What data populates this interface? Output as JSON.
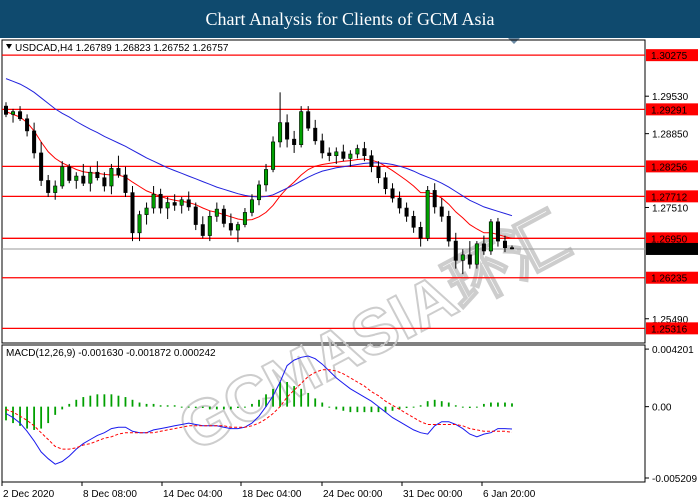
{
  "header": {
    "title": "Chart Analysis for Clients of GCM Asia"
  },
  "watermark": {
    "text": "GCMASIA环汇"
  },
  "chart_data": [
    {
      "type": "candlestick",
      "symbol_line": "USDCAD,H4  1.26789 1.26823 1.26752 1.26757",
      "ylim": [
        1.2505,
        1.3055
      ],
      "y_ticks": [
        "1.29530",
        "1.28850",
        "1.27510",
        "1.25490"
      ],
      "x_ticks": [
        "2 Dec 2020",
        "8 Dec 08:00",
        "14 Dec 04:00",
        "18 Dec 04:00",
        "24 Dec 00:00",
        "31 Dec 00:00",
        "6 Jan 20:00"
      ],
      "current_price": "1.26757",
      "levels": [
        "1.30275",
        "1.29291",
        "1.28256",
        "1.27712",
        "1.26950",
        "1.26235",
        "1.25316"
      ],
      "level_color": "#ff0000",
      "candles": [
        [
          1.2935,
          1.2942,
          1.2915,
          1.292
        ],
        [
          1.292,
          1.293,
          1.2905,
          1.2925
        ],
        [
          1.2925,
          1.2935,
          1.2908,
          1.2912
        ],
        [
          1.2912,
          1.292,
          1.288,
          1.289
        ],
        [
          1.289,
          1.2905,
          1.284,
          1.285
        ],
        [
          1.285,
          1.287,
          1.279,
          1.28
        ],
        [
          1.28,
          1.281,
          1.277,
          1.2778
        ],
        [
          1.2778,
          1.28,
          1.2765,
          1.279
        ],
        [
          1.279,
          1.2835,
          1.2785,
          1.2825
        ],
        [
          1.2825,
          1.283,
          1.2795,
          1.28
        ],
        [
          1.28,
          1.2815,
          1.2785,
          1.2808
        ],
        [
          1.2808,
          1.283,
          1.279,
          1.2795
        ],
        [
          1.2795,
          1.2825,
          1.278,
          1.2815
        ],
        [
          1.2815,
          1.2835,
          1.28,
          1.2805
        ],
        [
          1.2805,
          1.2815,
          1.278,
          1.279
        ],
        [
          1.279,
          1.283,
          1.2775,
          1.2822
        ],
        [
          1.2822,
          1.2845,
          1.2805,
          1.281
        ],
        [
          1.281,
          1.2825,
          1.277,
          1.2778
        ],
        [
          1.2778,
          1.279,
          1.269,
          1.2705
        ],
        [
          1.2705,
          1.2745,
          1.269,
          1.2738
        ],
        [
          1.2738,
          1.276,
          1.272,
          1.275
        ],
        [
          1.275,
          1.279,
          1.274,
          1.2775
        ],
        [
          1.2775,
          1.2785,
          1.274,
          1.275
        ],
        [
          1.275,
          1.277,
          1.273,
          1.276
        ],
        [
          1.276,
          1.2775,
          1.2745,
          1.2755
        ],
        [
          1.2755,
          1.277,
          1.274,
          1.2765
        ],
        [
          1.2765,
          1.278,
          1.2745,
          1.2752
        ],
        [
          1.2752,
          1.276,
          1.271,
          1.272
        ],
        [
          1.272,
          1.2735,
          1.2695,
          1.27
        ],
        [
          1.27,
          1.2745,
          1.269,
          1.2735
        ],
        [
          1.2735,
          1.276,
          1.2725,
          1.2748
        ],
        [
          1.2748,
          1.2755,
          1.2715,
          1.2722
        ],
        [
          1.2722,
          1.274,
          1.27,
          1.271
        ],
        [
          1.271,
          1.2725,
          1.2688,
          1.272
        ],
        [
          1.272,
          1.275,
          1.2715,
          1.2742
        ],
        [
          1.2742,
          1.2775,
          1.2735,
          1.2765
        ],
        [
          1.2765,
          1.28,
          1.2755,
          1.2792
        ],
        [
          1.2792,
          1.283,
          1.278,
          1.282
        ],
        [
          1.282,
          1.288,
          1.2815,
          1.287
        ],
        [
          1.287,
          1.296,
          1.286,
          1.2905
        ],
        [
          1.2905,
          1.292,
          1.286,
          1.2875
        ],
        [
          1.2875,
          1.289,
          1.285,
          1.2865
        ],
        [
          1.2865,
          1.2935,
          1.286,
          1.2925
        ],
        [
          1.2925,
          1.2935,
          1.289,
          1.2895
        ],
        [
          1.2895,
          1.291,
          1.2865,
          1.2872
        ],
        [
          1.2872,
          1.2885,
          1.284,
          1.285
        ],
        [
          1.285,
          1.286,
          1.2835,
          1.2845
        ],
        [
          1.2845,
          1.286,
          1.283,
          1.2852
        ],
        [
          1.2852,
          1.2865,
          1.2835,
          1.284
        ],
        [
          1.284,
          1.2855,
          1.2825,
          1.2848
        ],
        [
          1.2848,
          1.2865,
          1.284,
          1.2858
        ],
        [
          1.2858,
          1.287,
          1.2835,
          1.2845
        ],
        [
          1.2845,
          1.2855,
          1.2815,
          1.2825
        ],
        [
          1.2825,
          1.2835,
          1.2795,
          1.2805
        ],
        [
          1.2805,
          1.2815,
          1.2775,
          1.2785
        ],
        [
          1.2785,
          1.2795,
          1.276,
          1.2768
        ],
        [
          1.2768,
          1.278,
          1.274,
          1.275
        ],
        [
          1.275,
          1.276,
          1.2725,
          1.2735
        ],
        [
          1.2735,
          1.2745,
          1.2705,
          1.2715
        ],
        [
          1.2715,
          1.2725,
          1.268,
          1.2695
        ],
        [
          1.2695,
          1.279,
          1.269,
          1.2782
        ],
        [
          1.2782,
          1.2795,
          1.274,
          1.2752
        ],
        [
          1.2752,
          1.2768,
          1.2725,
          1.2735
        ],
        [
          1.2735,
          1.2745,
          1.268,
          1.269
        ],
        [
          1.269,
          1.2705,
          1.264,
          1.2655
        ],
        [
          1.2655,
          1.2675,
          1.263,
          1.2665
        ],
        [
          1.2665,
          1.269,
          1.264,
          1.2648
        ],
        [
          1.2648,
          1.269,
          1.264,
          1.2685
        ],
        [
          1.2685,
          1.27,
          1.2665,
          1.2672
        ],
        [
          1.2672,
          1.273,
          1.2665,
          1.2725
        ],
        [
          1.2725,
          1.2732,
          1.268,
          1.269
        ],
        [
          1.269,
          1.27,
          1.267,
          1.2678
        ],
        [
          1.2678,
          1.2682,
          1.2675,
          1.26757
        ]
      ],
      "ma_series": [
        {
          "color": "#ff0000",
          "values": [
            1.2925,
            1.292,
            1.2915,
            1.2905,
            1.289,
            1.287,
            1.2852,
            1.284,
            1.2832,
            1.2826,
            1.282,
            1.2816,
            1.2814,
            1.2813,
            1.2811,
            1.281,
            1.281,
            1.2806,
            1.2797,
            1.2789,
            1.2781,
            1.2776,
            1.2771,
            1.2767,
            1.2764,
            1.2762,
            1.276,
            1.2756,
            1.275,
            1.2745,
            1.2742,
            1.2738,
            1.2734,
            1.273,
            1.2728,
            1.2729,
            1.2734,
            1.2742,
            1.2755,
            1.2772,
            1.2786,
            1.2797,
            1.281,
            1.282,
            1.2826,
            1.2829,
            1.2831,
            1.2833,
            1.2835,
            1.2836,
            1.2838,
            1.2839,
            1.2837,
            1.2833,
            1.2826,
            1.2818,
            1.2809,
            1.28,
            1.279,
            1.2778,
            1.2778,
            1.2775,
            1.2768,
            1.2757,
            1.2743,
            1.2732,
            1.272,
            1.2712,
            1.2705,
            1.2705,
            1.2702,
            1.2698,
            1.2695
          ]
        },
        {
          "color": "#2222dd",
          "values": [
            1.2985,
            1.298,
            1.2975,
            1.2968,
            1.296,
            1.295,
            1.294,
            1.293,
            1.2922,
            1.2915,
            1.2907,
            1.29,
            1.2893,
            1.2887,
            1.288,
            1.2874,
            1.2868,
            1.2862,
            1.2855,
            1.2848,
            1.2841,
            1.2835,
            1.2829,
            1.2823,
            1.2818,
            1.2813,
            1.2808,
            1.2803,
            1.2798,
            1.2793,
            1.2788,
            1.2784,
            1.278,
            1.2776,
            1.2773,
            1.2771,
            1.277,
            1.2771,
            1.2774,
            1.278,
            1.2786,
            1.2792,
            1.2799,
            1.2806,
            1.2812,
            1.2817,
            1.282,
            1.2823,
            1.2825,
            1.2827,
            1.2829,
            1.2831,
            1.2832,
            1.2832,
            1.2831,
            1.2829,
            1.2826,
            1.2822,
            1.2817,
            1.2811,
            1.2806,
            1.2801,
            1.2795,
            1.2788,
            1.278,
            1.2772,
            1.2764,
            1.2758,
            1.2752,
            1.2748,
            1.2744,
            1.274,
            1.2736
          ]
        }
      ]
    },
    {
      "type": "macd",
      "label": "MACD(12,26,9) -0.001630 -0.001872 0.000242",
      "ylim": [
        -0.0055,
        0.0045
      ],
      "y_ticks": [
        "0.004201",
        "0.00",
        "-0.005209"
      ],
      "histogram": [
        -0.001,
        -0.0012,
        -0.0014,
        -0.0016,
        -0.0017,
        -0.0016,
        -0.0012,
        -0.0006,
        -0.0002,
        0.0002,
        0.0005,
        0.0007,
        0.0008,
        0.0009,
        0.0009,
        0.0009,
        0.0008,
        0.0007,
        0.0005,
        0.0003,
        0.0002,
        0.0002,
        0.0001,
        0.0001,
        0.0001,
        0.0,
        0.0,
        -0.0001,
        -0.0001,
        -0.0002,
        -0.0002,
        -0.0002,
        -0.0002,
        -0.0001,
        0.0,
        0.0002,
        0.0005,
        0.0009,
        0.0013,
        0.0018,
        0.0018,
        0.0015,
        0.0013,
        0.001,
        0.0006,
        0.0003,
        0.0,
        -0.0002,
        -0.0003,
        -0.0004,
        -0.0004,
        -0.0004,
        -0.0004,
        -0.0004,
        -0.0004,
        -0.0003,
        -0.0002,
        -0.0001,
        0.0,
        0.0001,
        0.0004,
        0.0005,
        0.0004,
        0.0003,
        0.0001,
        0.0,
        -0.0001,
        0.0,
        0.0002,
        0.0003,
        0.0003,
        0.0003,
        0.00024
      ],
      "macd": [
        -0.0005,
        -0.0008,
        -0.0012,
        -0.0018,
        -0.0025,
        -0.0033,
        -0.0038,
        -0.0042,
        -0.004,
        -0.0036,
        -0.0031,
        -0.0027,
        -0.0024,
        -0.0021,
        -0.0019,
        -0.0016,
        -0.0015,
        -0.0015,
        -0.0018,
        -0.0019,
        -0.0019,
        -0.0017,
        -0.0016,
        -0.0015,
        -0.0014,
        -0.0013,
        -0.0012,
        -0.0013,
        -0.0014,
        -0.0014,
        -0.0014,
        -0.0015,
        -0.0016,
        -0.0016,
        -0.0015,
        -0.0012,
        -0.0007,
        0.0,
        0.0008,
        0.0018,
        0.003,
        0.0034,
        0.0036,
        0.0037,
        0.0035,
        0.0031,
        0.0026,
        0.0021,
        0.0017,
        0.0013,
        0.001,
        0.0007,
        0.0004,
        0.0,
        -0.0004,
        -0.0008,
        -0.0011,
        -0.0014,
        -0.0017,
        -0.0019,
        -0.002,
        -0.0014,
        -0.0011,
        -0.0011,
        -0.0013,
        -0.0016,
        -0.002,
        -0.0022,
        -0.002,
        -0.0019,
        -0.0016,
        -0.0016,
        -0.00163
      ],
      "signal": [
        -0.0002,
        -0.0004,
        -0.0007,
        -0.001,
        -0.0014,
        -0.0019,
        -0.0024,
        -0.0029,
        -0.0031,
        -0.0031,
        -0.003,
        -0.0028,
        -0.0027,
        -0.0025,
        -0.0023,
        -0.0022,
        -0.002,
        -0.0019,
        -0.0019,
        -0.0019,
        -0.0019,
        -0.0019,
        -0.0018,
        -0.0017,
        -0.0016,
        -0.0015,
        -0.0014,
        -0.0014,
        -0.0014,
        -0.0014,
        -0.0014,
        -0.0014,
        -0.0015,
        -0.0015,
        -0.0015,
        -0.0014,
        -0.0012,
        -0.0009,
        -0.0005,
        0.0,
        0.0007,
        0.0012,
        0.0017,
        0.0022,
        0.0025,
        0.0027,
        0.0027,
        0.0026,
        0.0024,
        0.0021,
        0.0018,
        0.0015,
        0.0011,
        0.0008,
        0.0004,
        0.0001,
        -0.0002,
        -0.0005,
        -0.0008,
        -0.0011,
        -0.0013,
        -0.0013,
        -0.0013,
        -0.0013,
        -0.0013,
        -0.0014,
        -0.0016,
        -0.0017,
        -0.0018,
        -0.0018,
        -0.0018,
        -0.0018,
        -0.001872
      ]
    }
  ]
}
